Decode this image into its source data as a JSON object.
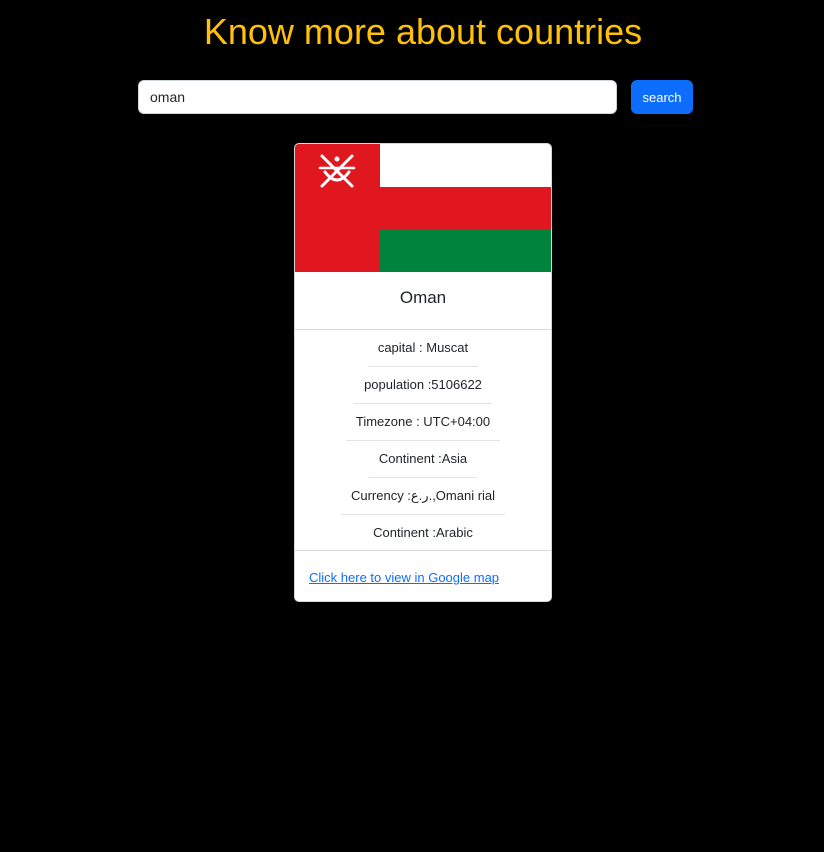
{
  "header": {
    "title": "Know more about countries"
  },
  "search": {
    "value": "oman",
    "button_label": "search"
  },
  "country": {
    "name": "Oman",
    "flag": {
      "colors": {
        "red": "#e0171f",
        "white": "#ffffff",
        "green": "#00843d",
        "emblem": "#ffffff"
      }
    },
    "details": [
      {
        "label": "capital : Muscat"
      },
      {
        "label": "population :5106622"
      },
      {
        "label": "Timezone : UTC+04:00"
      },
      {
        "label": "Continent :Asia"
      },
      {
        "label": "Currency :ر.ع.,Omani rial"
      },
      {
        "label": "Continent :Arabic"
      }
    ],
    "map_link_label": "Click here to view in Google map"
  },
  "colors": {
    "background": "#000000",
    "heading": "#ffc107",
    "primary": "#0d6efd"
  }
}
